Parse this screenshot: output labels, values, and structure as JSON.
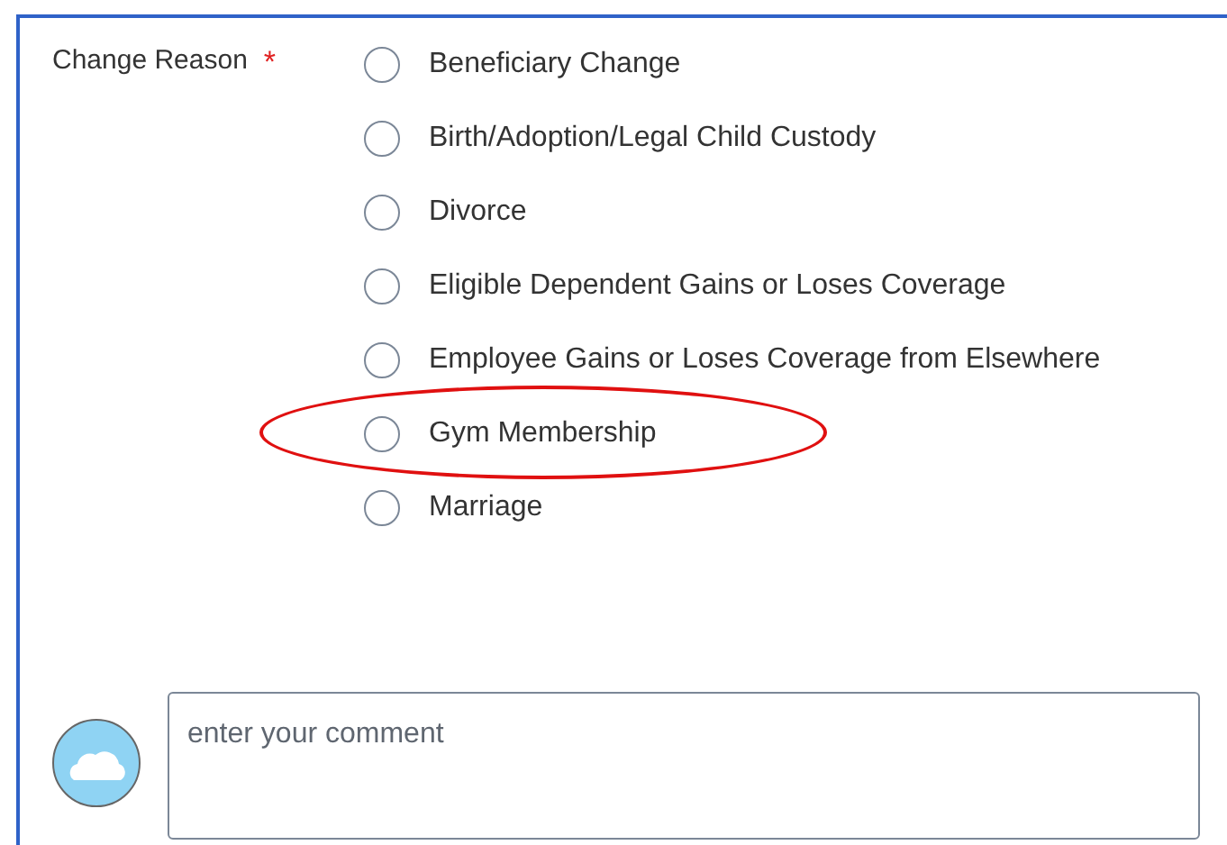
{
  "field": {
    "label": "Change Reason",
    "required_mark": "*",
    "options": [
      {
        "label": "Beneficiary Change",
        "selected": false,
        "circled": false
      },
      {
        "label": "Birth/Adoption/Legal Child Custody",
        "selected": false,
        "circled": false
      },
      {
        "label": "Divorce",
        "selected": false,
        "circled": false
      },
      {
        "label": "Eligible Dependent Gains or Loses Coverage",
        "selected": false,
        "circled": false
      },
      {
        "label": "Employee Gains or Loses Coverage from Elsewhere",
        "selected": false,
        "circled": false
      },
      {
        "label": "Gym Membership",
        "selected": false,
        "circled": true
      },
      {
        "label": "Marriage",
        "selected": false,
        "circled": false
      }
    ]
  },
  "comment": {
    "placeholder": "enter your comment"
  }
}
